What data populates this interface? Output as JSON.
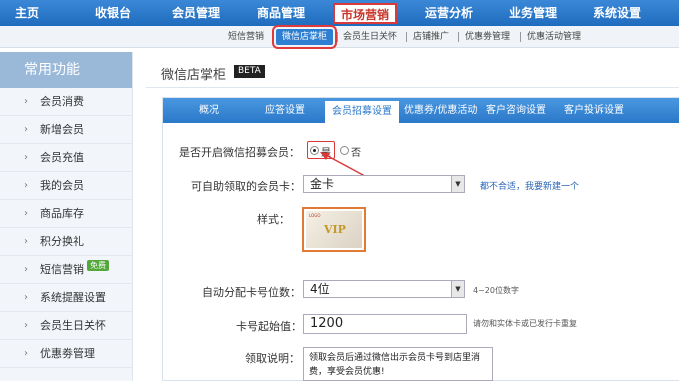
{
  "top_nav": [
    {
      "label": "主页"
    },
    {
      "label": "收银台"
    },
    {
      "label": "会员管理"
    },
    {
      "label": "商品管理"
    },
    {
      "label": "市场营销",
      "active": true
    },
    {
      "label": "运营分析"
    },
    {
      "label": "业务管理"
    },
    {
      "label": "系统设置"
    }
  ],
  "sub_nav": [
    {
      "label": "短信营销"
    },
    {
      "label": "微信店掌柜",
      "active": true
    },
    {
      "label": "会员生日关怀"
    },
    {
      "label": "店铺推广"
    },
    {
      "label": "优惠劵管理"
    },
    {
      "label": "优惠活动管理"
    }
  ],
  "sidebar": {
    "title": "常用功能",
    "items": [
      {
        "label": "会员消费"
      },
      {
        "label": "新增会员"
      },
      {
        "label": "会员充值"
      },
      {
        "label": "我的会员"
      },
      {
        "label": "商品库存"
      },
      {
        "label": "积分换礼"
      },
      {
        "label": "短信营销",
        "badge": "免费"
      },
      {
        "label": "系统提醒设置"
      },
      {
        "label": "会员生日关怀"
      },
      {
        "label": "优惠劵管理"
      }
    ]
  },
  "main": {
    "title": "微信店掌柜",
    "beta": "BETA"
  },
  "tabs": [
    {
      "label": "概况"
    },
    {
      "label": "应答设置"
    },
    {
      "label": "会员招募设置",
      "active": true
    },
    {
      "label": "优惠券/优惠活动"
    },
    {
      "label": "客户咨询设置"
    },
    {
      "label": "客户投诉设置"
    }
  ],
  "form": {
    "recruit_label": "是否开启微信招募会员：",
    "yes_label": "是",
    "no_label": "否",
    "card_label": "可自助领取的会员卡：",
    "card_value": "金卡",
    "card_link": "都不合适，我要新建一个",
    "style_label": "样式：",
    "card_vip": "VIP",
    "card_logo": "LOGO",
    "digits_label": "自动分配卡号位数：",
    "digits_value": "4位",
    "digits_hint": "4~20位数字",
    "start_label": "卡号起始值：",
    "start_value": "1200",
    "start_hint": "请勿和实体卡或已发行卡重复",
    "desc_label": "领取说明：",
    "desc_value": "领取会员后通过微信出示会员卡号到店里消费，享受会员优惠!"
  }
}
